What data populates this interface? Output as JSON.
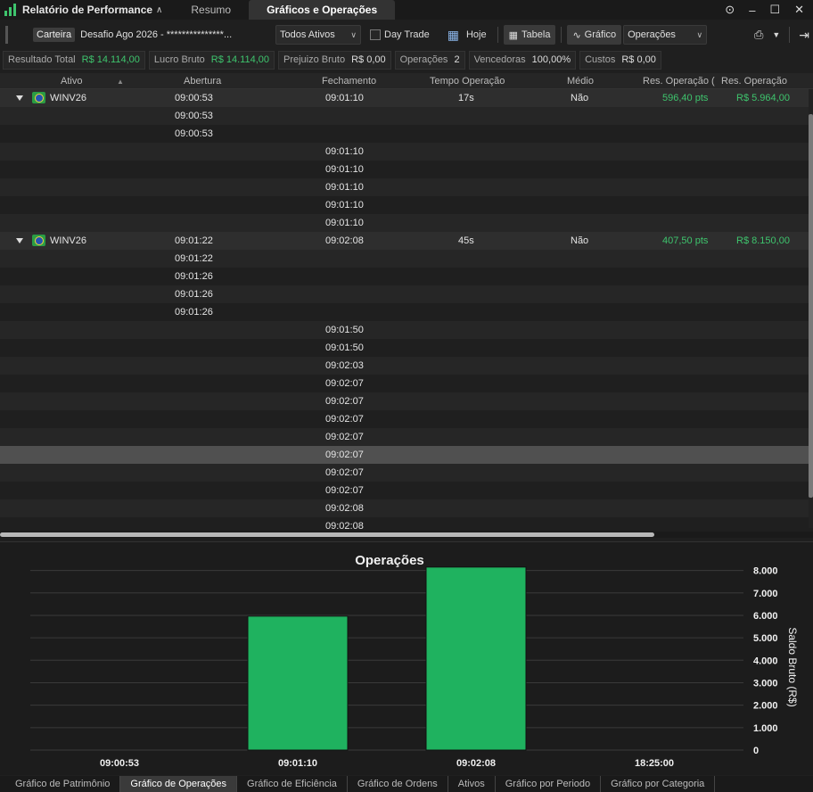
{
  "app": {
    "title": "Relatório de Performance",
    "tabs": [
      "Resumo",
      "Gráficos e Operações"
    ],
    "active_tab": "Gráficos e Operações"
  },
  "toolbar": {
    "carteira_label": "Carteira",
    "carteira_value": "Desafio Ago 2026 - ***************...",
    "ativos_value": "Todos Ativos",
    "daytrade_label": "Day Trade",
    "hoje_label": "Hoje",
    "tabela_label": "Tabela",
    "grafico_label": "Gráfico",
    "operacoes_value": "Operações"
  },
  "stats": [
    {
      "label": "Resultado Total",
      "value": "R$ 14.114,00",
      "positive": true
    },
    {
      "label": "Lucro Bruto",
      "value": "R$ 14.114,00",
      "positive": true
    },
    {
      "label": "Prejuizo Bruto",
      "value": "R$ 0,00",
      "positive": false
    },
    {
      "label": "Operações",
      "value": "2",
      "positive": false
    },
    {
      "label": "Vencedoras",
      "value": "100,00%",
      "positive": false
    },
    {
      "label": "Custos",
      "value": "R$ 0,00",
      "positive": false
    }
  ],
  "grid": {
    "columns": [
      "Ativo",
      "Abertura",
      "Fechamento",
      "Tempo Operação",
      "Médio",
      "Res. Operação (",
      "Res. Operação"
    ],
    "rows": [
      {
        "type": "group",
        "ativo": "WINV26",
        "abertura": "09:00:53",
        "fechamento": "09:01:10",
        "tempo": "17s",
        "medio": "Não",
        "pts": "596,40 pts",
        "res": "R$ 5.964,00"
      },
      {
        "abertura": "09:00:53"
      },
      {
        "abertura": "09:00:53"
      },
      {
        "fechamento": "09:01:10"
      },
      {
        "fechamento": "09:01:10"
      },
      {
        "fechamento": "09:01:10"
      },
      {
        "fechamento": "09:01:10"
      },
      {
        "fechamento": "09:01:10"
      },
      {
        "type": "group",
        "ativo": "WINV26",
        "abertura": "09:01:22",
        "fechamento": "09:02:08",
        "tempo": "45s",
        "medio": "Não",
        "pts": "407,50 pts",
        "res": "R$ 8.150,00"
      },
      {
        "abertura": "09:01:22"
      },
      {
        "abertura": "09:01:26"
      },
      {
        "abertura": "09:01:26"
      },
      {
        "abertura": "09:01:26"
      },
      {
        "fechamento": "09:01:50"
      },
      {
        "fechamento": "09:01:50"
      },
      {
        "fechamento": "09:02:03"
      },
      {
        "fechamento": "09:02:07"
      },
      {
        "fechamento": "09:02:07"
      },
      {
        "fechamento": "09:02:07"
      },
      {
        "fechamento": "09:02:07"
      },
      {
        "fechamento": "09:02:07",
        "selected": true
      },
      {
        "fechamento": "09:02:07"
      },
      {
        "fechamento": "09:02:07"
      },
      {
        "fechamento": "09:02:08"
      },
      {
        "fechamento": "09:02:08"
      }
    ]
  },
  "chart_data": {
    "type": "bar",
    "title": "Operações",
    "categories": [
      "09:00:53",
      "09:01:10",
      "09:02:08",
      "18:25:00"
    ],
    "values": [
      null,
      5964,
      8150,
      null
    ],
    "ylabel": "Saldo Bruto (R$)",
    "ylim": [
      0,
      8500
    ],
    "yticks": [
      "0",
      "1.000",
      "2.000",
      "3.000",
      "4.000",
      "5.000",
      "6.000",
      "7.000",
      "8.000"
    ],
    "bar_color": "#1fb25f",
    "grid": true
  },
  "bottom_tabs": [
    "Gráfico de Patrimônio",
    "Gráfico de Operações",
    "Gráfico de Eficiência",
    "Gráfico de Ordens",
    "Ativos",
    "Gráfico por Periodo",
    "Gráfico por Categoria"
  ],
  "bottom_active": "Gráfico de Operações"
}
